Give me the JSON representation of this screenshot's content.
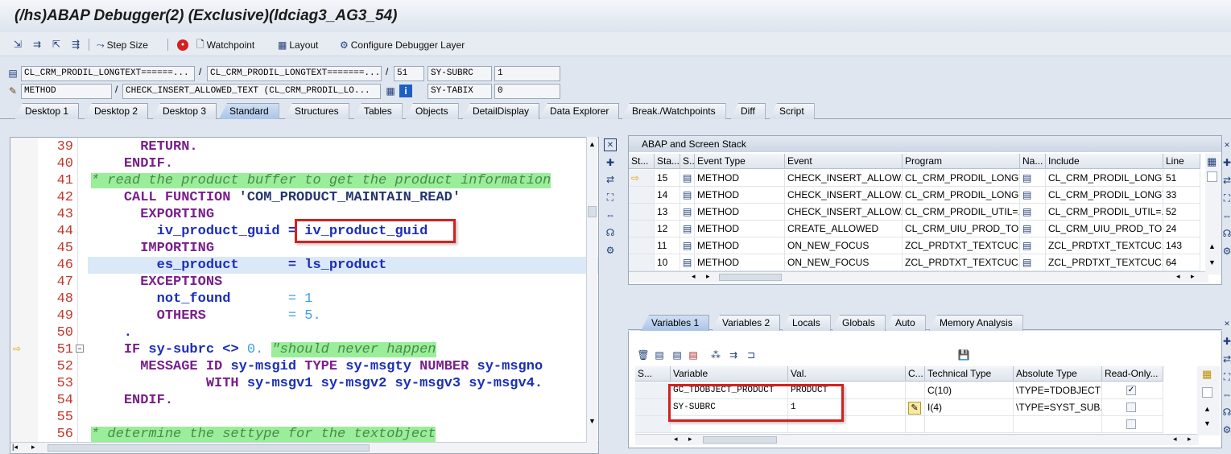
{
  "window": {
    "title": "(/hs)ABAP Debugger(2)  (Exclusive)(ldciag3_AG3_54)"
  },
  "toolbar": {
    "step_size": "Step Size",
    "watchpoint": "Watchpoint",
    "layout": "Layout",
    "configure": "Configure Debugger Layer"
  },
  "header": {
    "program_1": "CL_CRM_PRODIL_LONGTEXT======...",
    "program_2": "CL_CRM_PRODIL_LONGTEXT=======...",
    "line": "51",
    "sysubrc_label": "SY-SUBRC",
    "sysubrc_value": "1",
    "event_type": "METHOD",
    "event": "CHECK_INSERT_ALLOWED_TEXT (CL_CRM_PRODIL_LO...",
    "sytabix_label": "SY-TABIX",
    "sytabix_value": "0"
  },
  "tabs": [
    "Desktop 1",
    "Desktop 2",
    "Desktop 3",
    "Standard",
    "Structures",
    "Tables",
    "Objects",
    "DetailDisplay",
    "Data Explorer",
    "Break./Watchpoints",
    "Diff",
    "Script"
  ],
  "code": {
    "lines": [
      {
        "n": "39",
        "parts": [
          [
            "      ",
            "p"
          ],
          [
            "RETURN.",
            "k"
          ]
        ]
      },
      {
        "n": "40",
        "parts": [
          [
            "    ",
            "p"
          ],
          [
            "ENDIF.",
            "k"
          ]
        ]
      },
      {
        "n": "41",
        "parts": [
          [
            "* read the product buffer to get the product information",
            "c"
          ]
        ]
      },
      {
        "n": "42",
        "parts": [
          [
            "    ",
            "p"
          ],
          [
            "CALL FUNCTION ",
            "k"
          ],
          [
            "'COM_PRODUCT_MAINTAIN_READ'",
            "s"
          ]
        ]
      },
      {
        "n": "43",
        "parts": [
          [
            "      ",
            "p"
          ],
          [
            "EXPORTING",
            "k"
          ]
        ]
      },
      {
        "n": "44",
        "parts": [
          [
            "        iv_product_guid = iv_product_guid",
            "b"
          ]
        ]
      },
      {
        "n": "45",
        "parts": [
          [
            "      ",
            "p"
          ],
          [
            "IMPORTING",
            "k"
          ]
        ]
      },
      {
        "n": "46",
        "parts": [
          [
            "        es_product      = ls_product",
            "b"
          ]
        ]
      },
      {
        "n": "47",
        "parts": [
          [
            "      ",
            "p"
          ],
          [
            "EXCEPTIONS",
            "k"
          ]
        ]
      },
      {
        "n": "48",
        "parts": [
          [
            "        not_found       ",
            "b"
          ],
          [
            "= 1",
            "n"
          ]
        ]
      },
      {
        "n": "49",
        "parts": [
          [
            "        ",
            "p"
          ],
          [
            "OTHERS",
            "k"
          ],
          [
            "          ",
            "p"
          ],
          [
            "= 5.",
            "n"
          ]
        ]
      },
      {
        "n": "50",
        "parts": [
          [
            "    .",
            "b"
          ]
        ]
      },
      {
        "n": "51",
        "parts": [
          [
            "    ",
            "p"
          ],
          [
            "IF ",
            "k"
          ],
          [
            "sy-subrc <> ",
            "b"
          ],
          [
            "0. ",
            "n"
          ],
          [
            "\"should never happen",
            "c"
          ]
        ]
      },
      {
        "n": "52",
        "parts": [
          [
            "      ",
            "p"
          ],
          [
            "MESSAGE ID ",
            "k"
          ],
          [
            "sy-msgid ",
            "b"
          ],
          [
            "TYPE ",
            "k"
          ],
          [
            "sy-msgty ",
            "b"
          ],
          [
            "NUMBER ",
            "k"
          ],
          [
            "sy-msgno",
            "b"
          ]
        ]
      },
      {
        "n": "53",
        "parts": [
          [
            "              ",
            "p"
          ],
          [
            "WITH ",
            "k"
          ],
          [
            "sy-msgv1 sy-msgv2 sy-msgv3 sy-msgv4.",
            "b"
          ]
        ]
      },
      {
        "n": "54",
        "parts": [
          [
            "    ",
            "p"
          ],
          [
            "ENDIF.",
            "k"
          ]
        ]
      },
      {
        "n": "55",
        "parts": [
          [
            "",
            "p"
          ]
        ]
      },
      {
        "n": "56",
        "parts": [
          [
            "* determine the settype for the textobject",
            "c"
          ]
        ]
      }
    ]
  },
  "stack": {
    "title": "ABAP and Screen Stack",
    "columns": [
      "St...",
      "Sta...",
      "S...",
      "Event Type",
      "Event",
      "Program",
      "Na...",
      "Include",
      "Line"
    ],
    "rows": [
      {
        "level": "15",
        "type": "METHOD",
        "event": "CHECK_INSERT_ALLOW...",
        "program": "CL_CRM_PRODIL_LONGT...",
        "include": "CL_CRM_PRODIL_LONGT...",
        "line": "51"
      },
      {
        "level": "14",
        "type": "METHOD",
        "event": "CHECK_INSERT_ALLOW...",
        "program": "CL_CRM_PRODIL_LONGT...",
        "include": "CL_CRM_PRODIL_LONGT...",
        "line": "33"
      },
      {
        "level": "13",
        "type": "METHOD",
        "event": "CHECK_INSERT_ALLOW...",
        "program": "CL_CRM_PRODIL_UTIL=...",
        "include": "CL_CRM_PRODIL_UTIL=...",
        "line": "52"
      },
      {
        "level": "12",
        "type": "METHOD",
        "event": "CREATE_ALLOWED",
        "program": "CL_CRM_UIU_PROD_TO...",
        "include": "CL_CRM_UIU_PROD_TO...",
        "line": "24"
      },
      {
        "level": "11",
        "type": "METHOD",
        "event": "ON_NEW_FOCUS",
        "program": "ZCL_PRDTXT_TEXTCUC...",
        "include": "ZCL_PRDTXT_TEXTCUC...",
        "line": "143"
      },
      {
        "level": "10",
        "type": "METHOD",
        "event": "ON_NEW_FOCUS",
        "program": "ZCL_PRDTXT_TEXTCUC...",
        "include": "ZCL_PRDTXT_TEXTCUC...",
        "line": "64"
      }
    ]
  },
  "var_tabs": [
    "Variables 1",
    "Variables 2",
    "Locals",
    "Globals",
    "Auto",
    "Memory Analysis"
  ],
  "variables": {
    "columns": [
      "S...",
      "Variable",
      "Val.",
      "C...",
      "Technical Type",
      "Absolute Type",
      "Read-Only..."
    ],
    "rows": [
      {
        "variable": "GC_TDOBJECT_PRODUCT",
        "value": "PRODUCT",
        "tech": "C(10)",
        "abs": "\\TYPE=TDOBJECT",
        "readonly": true
      },
      {
        "variable": "SY-SUBRC",
        "value": "1",
        "tech": "I(4)",
        "abs": "\\TYPE=SYST_SUB...",
        "readonly": false
      }
    ]
  }
}
